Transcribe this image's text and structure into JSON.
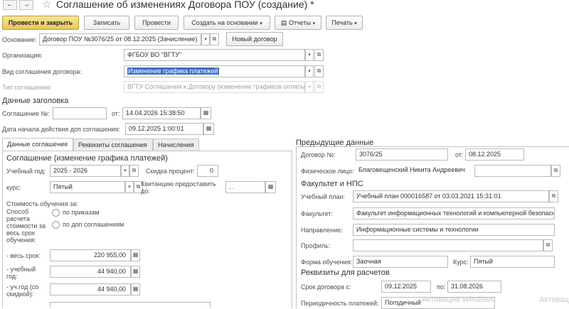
{
  "header": {
    "title": "Соглашение об изменениях Договора ПОУ (создание) *",
    "back_icon": "arrow-left",
    "forward_icon": "arrow-right",
    "star_icon": "star-outline"
  },
  "toolbar": {
    "post_close": "Провести и закрыть",
    "save": "Записать",
    "post": "Провести",
    "create_based": "Создать на основании",
    "reports": "Отчеты",
    "print": "Печать"
  },
  "basis": {
    "label": "Основание:",
    "value": "Договор ПОУ №3076/25 от 08.12.2025 (Зачисление)",
    "new_button": "Новый договор"
  },
  "org": {
    "label": "Организация:",
    "value": "ФГБОУ ВО \"ВГТУ\""
  },
  "agreement_kind": {
    "label": "Вид соглашения договора:",
    "value": "Изменение графика платежей"
  },
  "agreement_type": {
    "label": "Тип соглашения:",
    "value": "ВГТУ Соглашения к Договору (изменение графиков оплаты"
  },
  "header_data": {
    "title": "Данные заголовка",
    "number_label": "Соглашение №:",
    "number_value": "",
    "from_label": "от:",
    "from_value": "14.04.2026 15:38:50",
    "start_label": "Дата начала действия доп соглашения:",
    "start_value": "09.12.2025  1:00:01"
  },
  "tabs": [
    "Данные соглашения",
    "Реквизиты соглашения",
    "Начисления"
  ],
  "left": {
    "section_title": "Соглашение (изменение графика платежей)",
    "year_label": "Учебный год:",
    "year_value": "2025 - 2026",
    "discount_label": "Скидка процент:",
    "discount_value": "0",
    "course_label": "курс:",
    "course_value": "Пятый",
    "receipt_label": "Квитанцию предоставить до:",
    "receipt_value": " .  .",
    "cost_title": "Стоимость обучения за:",
    "method_label": "Способ расчета стоимости за весь срок обучения:",
    "radio_orders": "по приказам",
    "radio_agreements": "по доп соглашениям",
    "full_label": "- весь срок:",
    "full_value": "220 955,00",
    "year_cost_label": "- учебный год:",
    "year_cost_value": "44 940,00",
    "discount_cost_label": "- уч.год (со скидкой):",
    "discount_cost_value": "44 940,00"
  },
  "right": {
    "title": "Предыдущие данные",
    "contract_label": "Договор №:",
    "contract_value": "3076/25",
    "contract_from_label": "от:",
    "contract_from_value": "08.12.2025",
    "person_label": "Физическое лицо:",
    "person_value": "Благовещенский Никита Андреевич",
    "faculty_title": "Факультет и НПС",
    "plan_label": "Учебный план:",
    "plan_value": "Учебный план 000016587 от 03.03.2021 15:31:01",
    "faculty_label": "Факультет:",
    "faculty_value": "Факультет информационных технологий и компьютерной безопасности",
    "direction_label": "Направление:",
    "direction_value": "Информационные системы и технологии",
    "profile_label": "Профиль:",
    "profile_value": "",
    "form_label": "Форма обучения:",
    "form_value": "Заочная",
    "course_label": "Курс:",
    "course_value": "Пятый",
    "req_title": "Реквизиты для расчетов",
    "term_label": "Срок договора с:",
    "term_from": "09.12.2025",
    "term_to_label": "по:",
    "term_to": "31.08.2026",
    "period_label": "Периодичность платежей:",
    "period_value": "Погодичный"
  },
  "watermark": {
    "text1": "Активация Windows",
    "text2": "Активац"
  }
}
